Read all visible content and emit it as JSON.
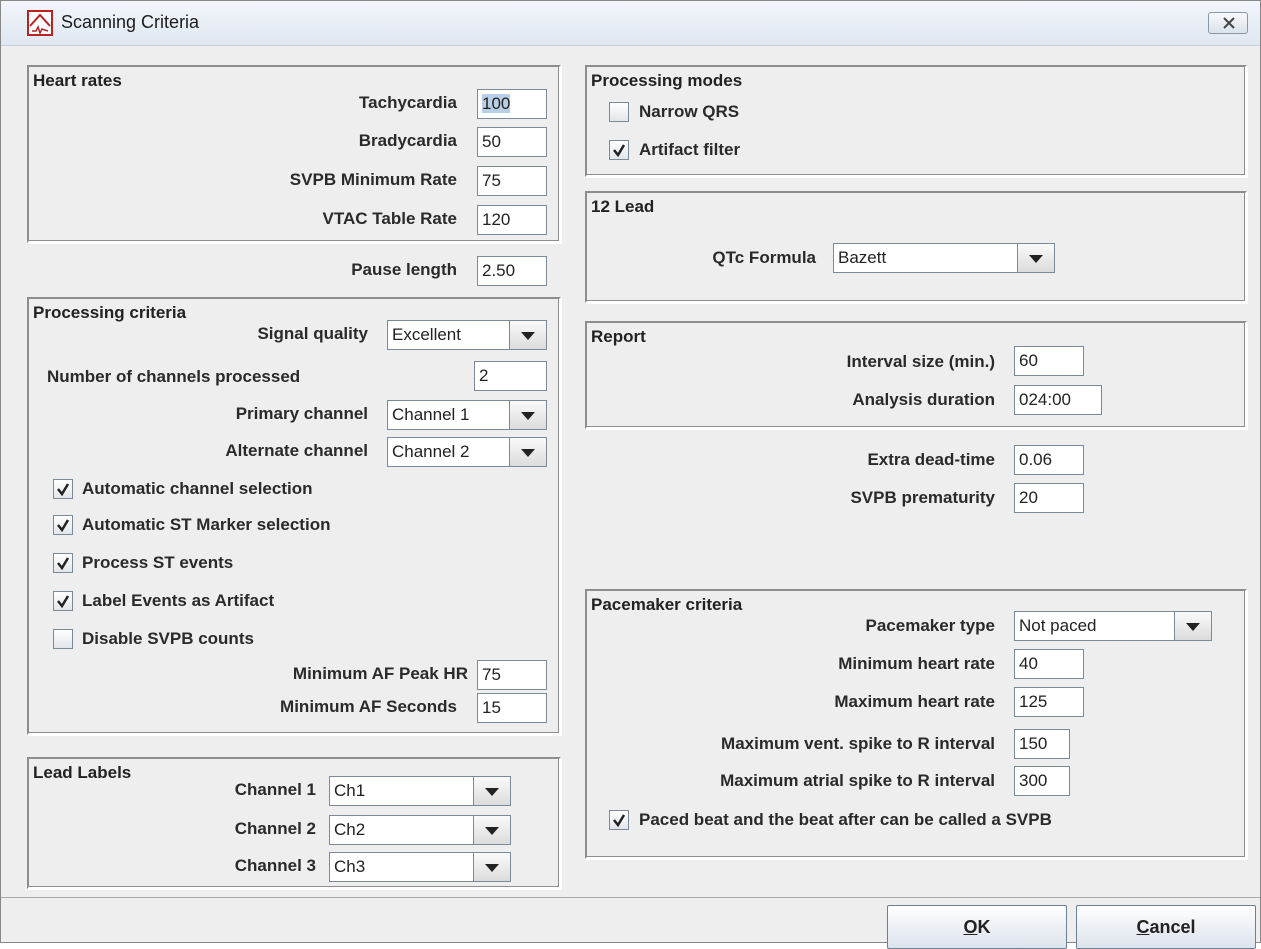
{
  "window": {
    "title": "Scanning Criteria"
  },
  "heart_rates": {
    "title": "Heart rates",
    "tachycardia": {
      "label": "Tachycardia",
      "value": "100"
    },
    "bradycardia": {
      "label": "Bradycardia",
      "value": "50"
    },
    "svpb_min_rate": {
      "label": "SVPB Minimum Rate",
      "value": "75"
    },
    "vtac_table_rate": {
      "label": "VTAC Table Rate",
      "value": "120"
    }
  },
  "pause_length": {
    "label": "Pause length",
    "value": "2.50"
  },
  "processing_criteria": {
    "title": "Processing criteria",
    "signal_quality": {
      "label": "Signal quality",
      "value": "Excellent"
    },
    "channels_processed": {
      "label": "Number of channels processed",
      "value": "2"
    },
    "primary_channel": {
      "label": "Primary channel",
      "value": "Channel 1"
    },
    "alternate_channel": {
      "label": "Alternate channel",
      "value": "Channel 2"
    },
    "checkboxes": [
      {
        "label": "Automatic channel selection",
        "checked": true
      },
      {
        "label": "Automatic ST Marker selection",
        "checked": true
      },
      {
        "label": "Process ST events",
        "checked": true
      },
      {
        "label": "Label Events as Artifact",
        "checked": true
      },
      {
        "label": "Disable SVPB counts",
        "checked": false
      }
    ],
    "min_af_peak_hr": {
      "label": "Minimum AF Peak HR",
      "value": "75"
    },
    "min_af_seconds": {
      "label": "Minimum AF Seconds",
      "value": "15"
    }
  },
  "lead_labels": {
    "title": "Lead Labels",
    "channels": [
      {
        "label": "Channel 1",
        "value": "Ch1"
      },
      {
        "label": "Channel 2",
        "value": "Ch2"
      },
      {
        "label": "Channel 3",
        "value": "Ch3"
      }
    ]
  },
  "processing_modes": {
    "title": "Processing modes",
    "narrow_qrs": {
      "label": "Narrow QRS",
      "checked": false
    },
    "artifact_filter": {
      "label": "Artifact filter",
      "checked": true
    }
  },
  "twelve_lead": {
    "title": "12 Lead",
    "qtc_formula": {
      "label": "QTc Formula",
      "value": "Bazett"
    }
  },
  "report": {
    "title": "Report",
    "interval_size": {
      "label": "Interval size (min.)",
      "value": "60"
    },
    "analysis_duration": {
      "label": "Analysis duration",
      "value": "024:00"
    }
  },
  "extra_dead_time": {
    "label": "Extra dead-time",
    "value": "0.06"
  },
  "svpb_prematurity": {
    "label": "SVPB prematurity",
    "value": "20"
  },
  "pacemaker": {
    "title": "Pacemaker criteria",
    "type": {
      "label": "Pacemaker type",
      "value": "Not paced"
    },
    "min_hr": {
      "label": "Minimum heart rate",
      "value": "40"
    },
    "max_hr": {
      "label": "Maximum heart rate",
      "value": "125"
    },
    "vent_spike": {
      "label": "Maximum vent. spike  to R interval",
      "value": "150"
    },
    "atrial_spike": {
      "label": "Maximum atrial spike to R interval",
      "value": "300"
    },
    "paced_beat": {
      "label": "Paced beat and the beat after can be called a SVPB",
      "checked": true
    }
  },
  "buttons": {
    "ok_mnemonic": "O",
    "ok_rest": "K",
    "cancel_mnemonic": "C",
    "cancel_rest": "ancel"
  },
  "colors": {
    "accent": "#b8cfe5",
    "window_bg": "#eeeeee"
  }
}
